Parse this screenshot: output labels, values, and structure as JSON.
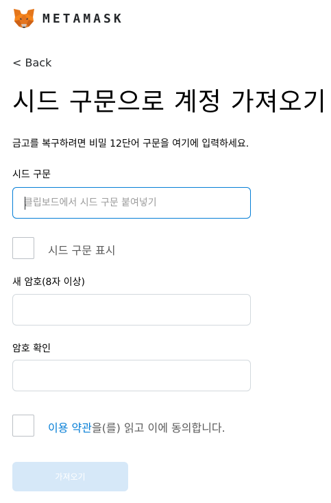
{
  "header": {
    "brand": "METAMASK",
    "logo_icon": "metamask-fox-icon"
  },
  "nav": {
    "back_label": "< Back"
  },
  "page": {
    "title": "시드 구문으로 계정 가져오기",
    "description": "금고를 복구하려면 비밀 12단어 구문을 여기에 입력하세요."
  },
  "seed": {
    "label": "시드 구문",
    "placeholder": "클립보드에서 시드 구문 붙여넣기",
    "value": "",
    "show_label": "시드 구문 표시",
    "show_checked": false
  },
  "password": {
    "label": "새 암호(8자 이상)",
    "value": ""
  },
  "confirm": {
    "label": "암호 확인",
    "value": ""
  },
  "terms": {
    "link_text": "이용 약관",
    "rest_text": "을(를) 읽고 이에 동의합니다.",
    "checked": false
  },
  "actions": {
    "import_label": "가져오기",
    "import_disabled": true
  },
  "colors": {
    "accent": "#037dd6",
    "button_disabled_bg": "#d6e8f8",
    "fox_orange": "#e2761b"
  }
}
